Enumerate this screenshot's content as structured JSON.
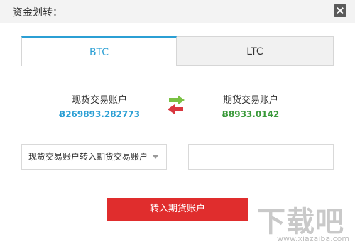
{
  "window": {
    "title": "资金划转：",
    "close_icon": "close-icon"
  },
  "tabs": [
    {
      "label": "BTC",
      "active": true
    },
    {
      "label": "LTC",
      "active": false
    }
  ],
  "accounts": {
    "source": {
      "label": "现货交易账户",
      "balance": "Ƀ269893.282773"
    },
    "target": {
      "label": "期货交易账户",
      "balance": "Ƀ8933.0142"
    },
    "swap_icon": "swap-arrows-icon"
  },
  "transfer": {
    "direction_selected": "现货交易账户转入期货交易账户",
    "amount_value": "",
    "submit_label": "转入期货账户"
  },
  "watermark": {
    "main": "下载吧",
    "sub": "www.xiazaiba.com"
  },
  "colors": {
    "accent_blue": "#2b9fd4",
    "balance_green": "#3a9a3a",
    "button_red": "#e02d2d",
    "arrow_green": "#7ac143",
    "arrow_red": "#d9363e"
  }
}
